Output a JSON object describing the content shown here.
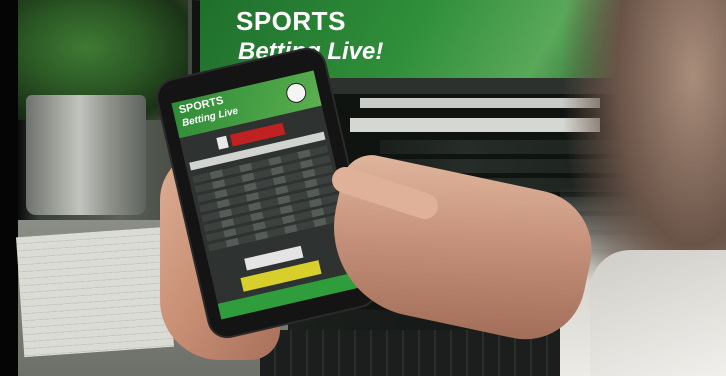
{
  "monitor": {
    "headline_line1": "SPORTS",
    "headline_line2": "Betting Live!"
  },
  "phone": {
    "app_title": "SPORTS",
    "app_subtitle": "Betting Live"
  },
  "colors": {
    "brand_green": "#2f8f3a",
    "live_red": "#c02121",
    "bet_yellow": "#d9cf2c"
  }
}
